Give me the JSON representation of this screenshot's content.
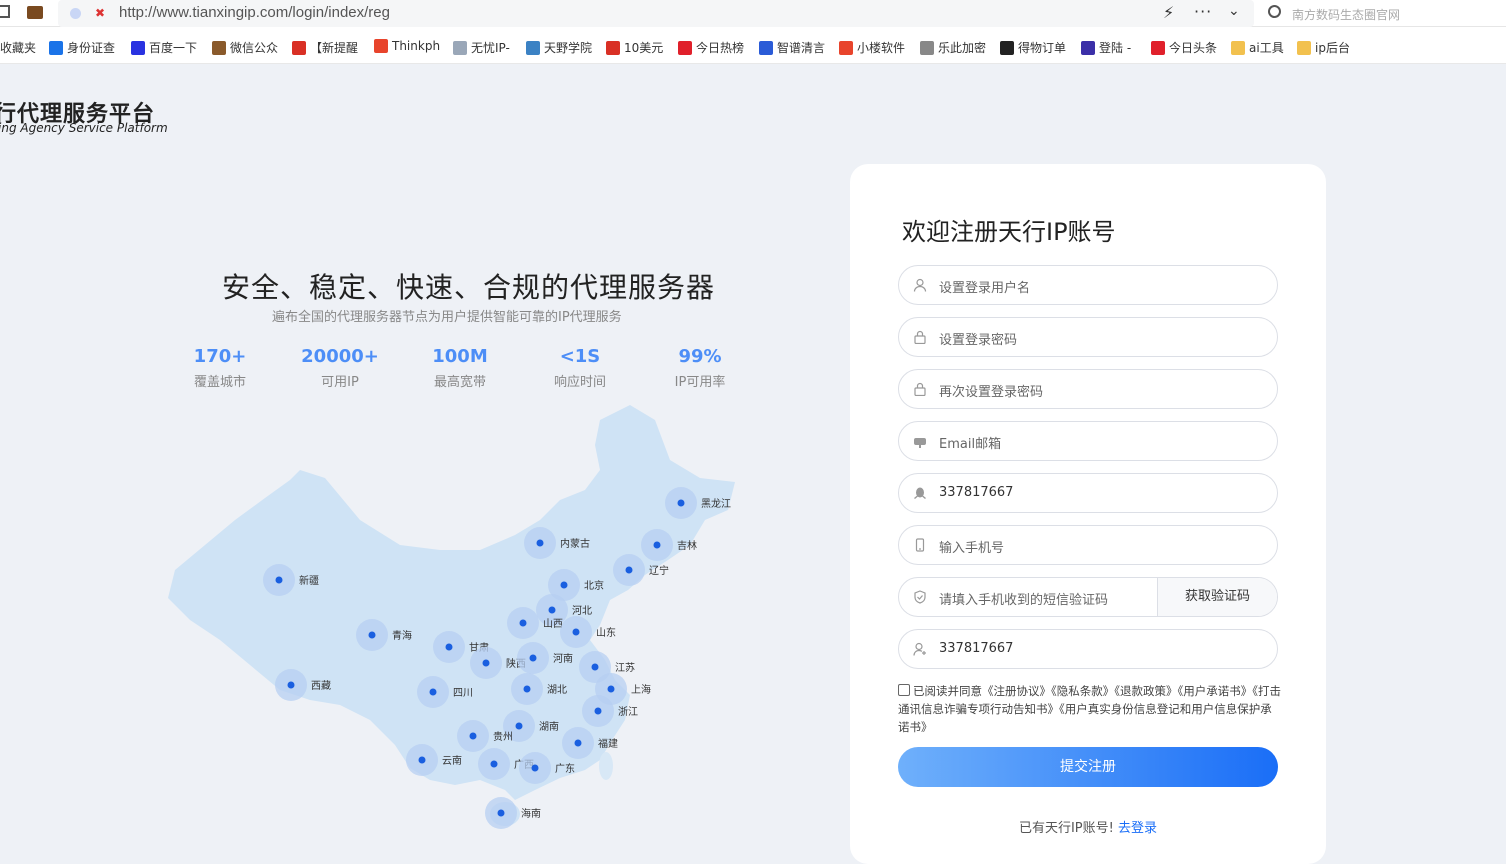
{
  "browser": {
    "url": "http://www.tianxingip.com/login/index/reg",
    "search_placeholder": "南方数码生态圈官网"
  },
  "bookmarks": [
    {
      "label": "收藏夹",
      "icon": "star-icon",
      "color": "#f0b400"
    },
    {
      "label": "身份证查",
      "icon": "idcard-icon",
      "color": "#1a73e8"
    },
    {
      "label": "百度一下",
      "icon": "baidu-icon",
      "color": "#2932e1"
    },
    {
      "label": "微信公众",
      "icon": "wechat-icon",
      "color": "#8a5a2b"
    },
    {
      "label": "【新提醒",
      "icon": "news-icon",
      "color": "#d93025"
    },
    {
      "label": "Thinkph",
      "icon": "thinkphp-icon",
      "color": "#e8442c"
    },
    {
      "label": "无忧IP-",
      "icon": "doc-icon",
      "color": "#9aa7b8"
    },
    {
      "label": "天野学院",
      "icon": "shield-icon",
      "color": "#3b82c4"
    },
    {
      "label": "10美元",
      "icon": "vps-icon",
      "color": "#d93025"
    },
    {
      "label": "今日热榜",
      "icon": "r-icon",
      "color": "#e0202b"
    },
    {
      "label": "智谱清言",
      "icon": "zhipu-icon",
      "color": "#2a5bd7"
    },
    {
      "label": "小楼软件",
      "icon": "flame-icon",
      "color": "#e8442c"
    },
    {
      "label": "乐此加密",
      "icon": "globe-icon",
      "color": "#888888"
    },
    {
      "label": "得物订单",
      "icon": "dewu-icon",
      "color": "#222222"
    },
    {
      "label": "登陆 -",
      "icon": "app-icon",
      "color": "#3b2fa8"
    },
    {
      "label": "今日头条",
      "icon": "toutiao-icon",
      "color": "#e0202b"
    },
    {
      "label": "ai工具",
      "icon": "folder-icon",
      "color": "#f2c14e"
    },
    {
      "label": "ip后台",
      "icon": "folder-icon",
      "color": "#f2c14e"
    }
  ],
  "brand": {
    "name_cn": "行代理服务平台",
    "name_en": "ing Agency Service Platform"
  },
  "hero": {
    "title": "安全、稳定、快速、合规的代理服务器",
    "subtitle": "遍布全国的代理服务器节点为用户提供智能可靠的IP代理服务"
  },
  "stats": [
    {
      "value": "170+",
      "label": "覆盖城市"
    },
    {
      "value": "20000+",
      "label": "可用IP"
    },
    {
      "value": "100M",
      "label": "最高宽带"
    },
    {
      "value": "<1S",
      "label": "响应时间"
    },
    {
      "value": "99%",
      "label": "IP可用率"
    }
  ],
  "map_nodes": [
    "黑龙江",
    "内蒙古",
    "吉林",
    "辽宁",
    "新疆",
    "北京",
    "河北",
    "山西",
    "山东",
    "青海",
    "甘肃",
    "陕西",
    "河南",
    "江苏",
    "西藏",
    "四川",
    "湖北",
    "上海",
    "浙江",
    "湖南",
    "贵州",
    "福建",
    "云南",
    "广西",
    "广东",
    "海南"
  ],
  "form": {
    "title": "欢迎注册天行IP账号",
    "username_placeholder": "设置登录用户名",
    "password_placeholder": "设置登录密码",
    "password2_placeholder": "再次设置登录密码",
    "email_placeholder": "Email邮箱",
    "qq_value": "337817667",
    "phone_placeholder": "输入手机号",
    "sms_placeholder": "请填入手机收到的短信验证码",
    "sms_button": "获取验证码",
    "referrer_value": "337817667",
    "agreement": "已阅读并同意《注册协议》《隐私条款》《退款政策》《用户承诺书》《打击通讯信息诈骗专项行动告知书》《用户真实身份信息登记和用户信息保护承诺书》",
    "submit": "提交注册",
    "has_account": "已有天行IP账号!",
    "login_link": "去登录"
  }
}
